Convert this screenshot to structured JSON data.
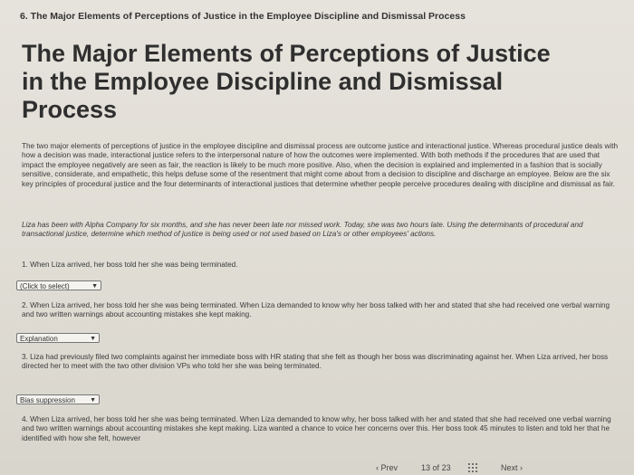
{
  "header": {
    "breadcrumb": "6. The Major Elements of Perceptions of Justice in the Employee Discipline and Dismissal Process"
  },
  "main": {
    "title": "The Major Elements of Perceptions of Justice in the Employee Discipline and Dismissal Process",
    "intro": "The two major elements of perceptions of justice in the employee discipline and dismissal process are outcome justice and interactional justice. Whereas procedural justice deals with how a decision was made, interactional justice refers to the interpersonal nature of how the outcomes were implemented. With both methods if the procedures that are used that impact the employee negatively are seen as fair, the reaction is likely to be much more positive. Also, when the decision is explained and implemented in a fashion that is socially sensitive, considerate, and empathetic, this helps defuse some of the resentment that might come about from a decision to discipline and discharge an employee. Below are the six key principles of procedural justice and the four determinants of interactional justices that determine whether people perceive procedures dealing with discipline and dismissal as fair.",
    "scenario": "Liza has been with Alpha Company for six months, and she has never been late nor missed work. Today, she was two hours late. Using the determinants of procedural and transactional justice, determine which method of justice is being used or not used based on Liza's or other employees' actions."
  },
  "questions": [
    {
      "text": "1. When Liza arrived, her boss told her she was being terminated.",
      "selected": "(Click to select)"
    },
    {
      "text": "2. When Liza arrived, her boss told her she was being terminated. When Liza demanded to know why her boss talked with her and stated that she had received one verbal warning and two written warnings about accounting mistakes she kept making.",
      "selected": "Explanation"
    },
    {
      "text": "3. Liza had previously filed two complaints against her immediate boss with HR stating that she felt as though her boss was discriminating against her. When Liza arrived, her boss directed her to meet with the two other division VPs who told her she was being terminated.",
      "selected": "Bias suppression"
    },
    {
      "text": "4. When Liza arrived, her boss told her she was being terminated. When Liza demanded to know why, her boss talked with her and stated that she had received one verbal warning and two written warnings about accounting mistakes she kept making. Liza wanted a chance to voice her concerns over this. Her boss took 45 minutes to listen and told her that he identified with how she felt, however"
    }
  ],
  "footer": {
    "prev_label": "Prev",
    "page_current": "13",
    "page_of": "of",
    "page_total": "23",
    "next_label": "Next"
  },
  "icons": {
    "prev": "chevron-left-icon",
    "next": "chevron-right-icon",
    "grid": "grid-icon",
    "dropdown": "chevron-down-icon"
  }
}
